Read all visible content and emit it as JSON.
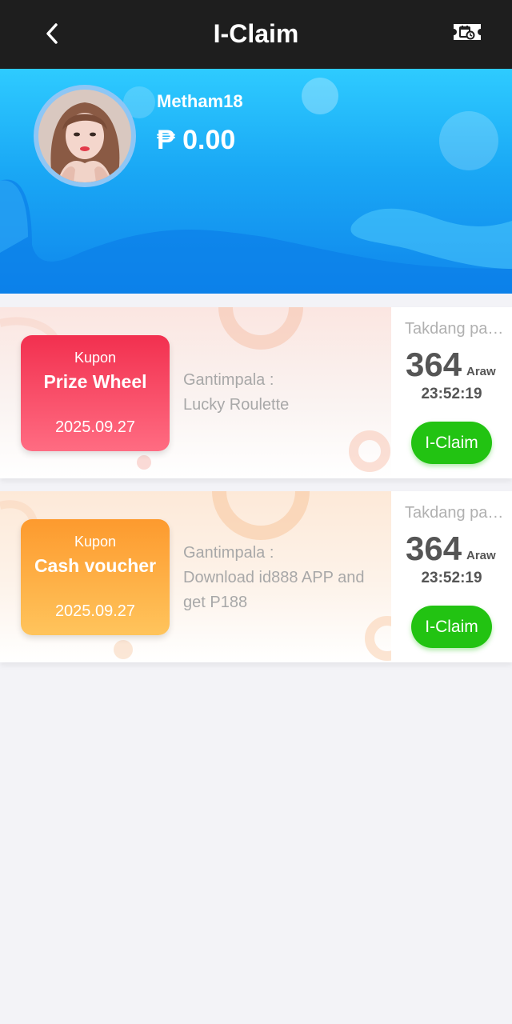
{
  "header": {
    "title": "I-Claim",
    "back_icon": "chevron-left-icon",
    "ticket_icon": "ticket-icon"
  },
  "profile": {
    "username": "Metham18",
    "balance": "₱ 0.00"
  },
  "coupons": [
    {
      "kupon_label": "Kupon",
      "title": "Prize Wheel",
      "date": "2025.09.27",
      "prize_label": "Gantimpala :",
      "prize": "Lucky Roulette",
      "deadline_label": "Takdang panahon",
      "days": "364",
      "days_unit": "Araw",
      "time": "23:52:19",
      "claim_label": "I-Claim",
      "color": "#f2304f"
    },
    {
      "kupon_label": "Kupon",
      "title": "Cash voucher",
      "date": "2025.09.27",
      "prize_label": "Gantimpala :",
      "prize": "Download id888 APP and get P188",
      "deadline_label": "Takdang panahon",
      "days": "364",
      "days_unit": "Araw",
      "time": "23:52:19",
      "claim_label": "I-Claim",
      "color": "#fd9a2e"
    }
  ],
  "colors": {
    "topbar": "#1e1e1e",
    "hero_top": "#2ecbff",
    "hero_bottom": "#0f86ec",
    "claim_button": "#22c312"
  }
}
